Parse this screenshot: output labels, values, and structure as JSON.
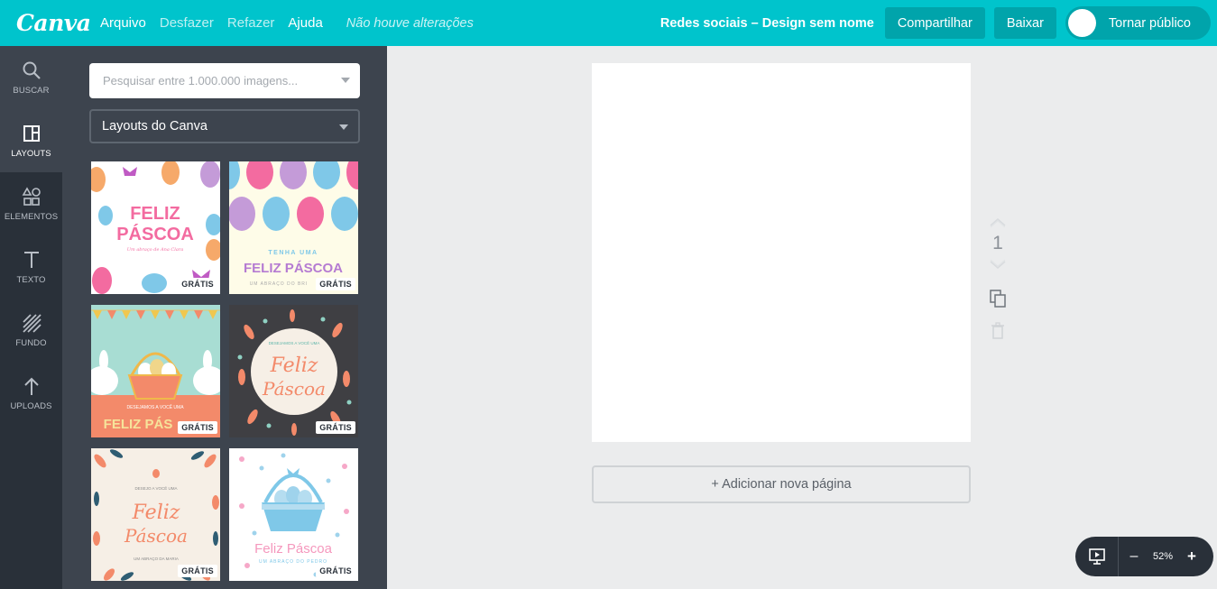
{
  "app": {
    "logo": "Canva"
  },
  "topbar": {
    "menu": [
      "Arquivo",
      "Desfazer",
      "Refazer",
      "Ajuda"
    ],
    "status": "Não houve alterações",
    "doc_title": "Redes sociais – Design sem nome",
    "share_label": "Compartilhar",
    "download_label": "Baixar",
    "public_toggle_label": "Tornar público"
  },
  "sidebar": {
    "items": [
      {
        "label": "BUSCAR",
        "icon": "search-icon"
      },
      {
        "label": "LAYOUTS",
        "icon": "layouts-icon"
      },
      {
        "label": "ELEMENTOS",
        "icon": "elements-icon"
      },
      {
        "label": "TEXTO",
        "icon": "text-icon"
      },
      {
        "label": "FUNDO",
        "icon": "background-icon"
      },
      {
        "label": "UPLOADS",
        "icon": "upload-icon"
      }
    ]
  },
  "panel": {
    "search_placeholder": "Pesquisar entre 1.000.000 imagens...",
    "layout_select": "Layouts do Canva",
    "badge": "GRÁTIS",
    "templates": [
      {
        "title_1": "FELIZ",
        "title_2": "PÁSCOA",
        "subtitle": "Um abraço de Ana Clara"
      },
      {
        "pre": "TENHA UMA",
        "title": "FELIZ PÁSCOA",
        "subtitle": "UM ABRAÇO DO BRI"
      },
      {
        "pre": "DESEJAMOS A VOCÊ UMA",
        "title": "FELIZ PÁS"
      },
      {
        "pre": "DESEJAMOS A VOCÊ UMA",
        "title_1": "Feliz",
        "title_2": "Páscoa"
      },
      {
        "pre": "DESEJO A VOCÊ UMA",
        "title_1": "Feliz",
        "title_2": "Páscoa",
        "subtitle": "UM ABRAÇO DA MARIA"
      },
      {
        "title": "Feliz Páscoa",
        "subtitle": "UM ABRAÇO DO PEDRO"
      }
    ]
  },
  "canvas": {
    "page_number": "1",
    "add_page_label": "+ Adicionar nova página"
  },
  "zoom": {
    "value": "52%",
    "minus": "–",
    "plus": "+"
  }
}
